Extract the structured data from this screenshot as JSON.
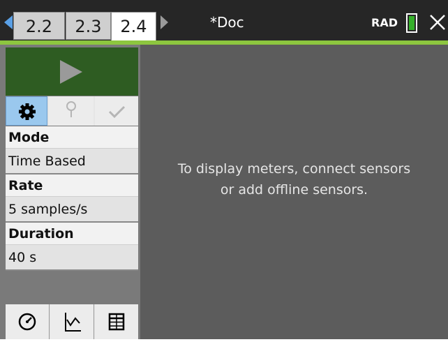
{
  "header": {
    "tabs": [
      "2.2",
      "2.3",
      "2.4"
    ],
    "active_tab": "2.4",
    "document_title": "*Doc",
    "angle_mode": "RAD"
  },
  "sidebar": {
    "settings": [
      {
        "label": "Mode",
        "value": "Time Based"
      },
      {
        "label": "Rate",
        "value": "5 samples/s"
      },
      {
        "label": "Duration",
        "value": "40 s"
      }
    ]
  },
  "main": {
    "message_line1": "To display meters, connect sensors",
    "message_line2": "or add offline sensors."
  },
  "colors": {
    "accent": "#8dc63f",
    "play_button": "#2e5c22",
    "selected_tool": "#9ac8ee",
    "battery": "#35b02a",
    "main_background": "#5c5c5c"
  },
  "icons": [
    "left-arrow-icon",
    "right-arrow-icon",
    "battery-icon",
    "close-icon",
    "play-icon",
    "gear-icon",
    "pin-icon",
    "check-icon",
    "meter-icon",
    "graph-icon",
    "table-icon"
  ]
}
